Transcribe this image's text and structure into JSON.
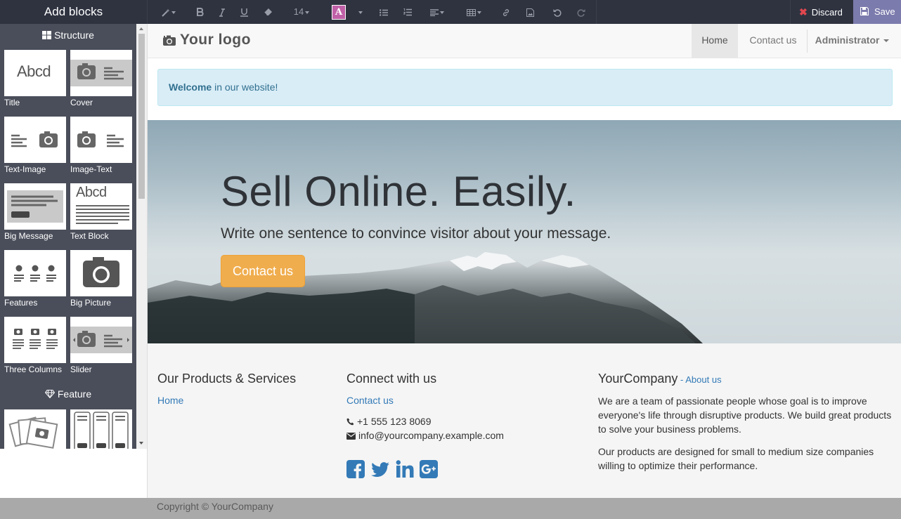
{
  "panel": {
    "title": "Add blocks",
    "sections": [
      {
        "title": "Structure",
        "icon": "th-large-icon"
      },
      {
        "title": "Feature",
        "icon": "diamond-icon"
      }
    ],
    "blocks": [
      {
        "label": "Title"
      },
      {
        "label": "Cover"
      },
      {
        "label": "Text-Image"
      },
      {
        "label": "Image-Text"
      },
      {
        "label": "Big Message"
      },
      {
        "label": "Text Block"
      },
      {
        "label": "Features"
      },
      {
        "label": "Big Picture"
      },
      {
        "label": "Three Columns"
      },
      {
        "label": "Slider"
      }
    ],
    "thumb_text": "Abcd"
  },
  "toolbar": {
    "font_size": "14",
    "text_color_letter": "A",
    "text_color": "#c061a8",
    "discard_label": "Discard",
    "save_label": "Save"
  },
  "site": {
    "logo_text": "Your logo",
    "nav": {
      "home": "Home",
      "contact": "Contact us",
      "admin": "Administrator"
    },
    "welcome_bold": "Welcome",
    "welcome_rest": " in our website!",
    "hero": {
      "title": "Sell Online. Easily.",
      "subtitle": "Write one sentence to convince visitor about your message.",
      "button": "Contact us"
    },
    "footer": {
      "col1_title": "Our Products & Services",
      "col1_link": "Home",
      "col2_title": "Connect with us",
      "col2_link": "Contact us",
      "phone": "+1 555 123 8069",
      "email": "info@yourcompany.example.com",
      "col3_title": "YourCompany",
      "col3_about_link": "About us",
      "about_p1": "We are a team of passionate people whose goal is to improve everyone's life through disruptive products. We build great products to solve your business problems.",
      "about_p2": "Our products are designed for small to medium size companies willing to optimize their performance.",
      "social": [
        "facebook-icon",
        "twitter-icon",
        "linkedin-icon",
        "google-plus-icon"
      ]
    },
    "copyright": "Copyright © YourCompany"
  }
}
